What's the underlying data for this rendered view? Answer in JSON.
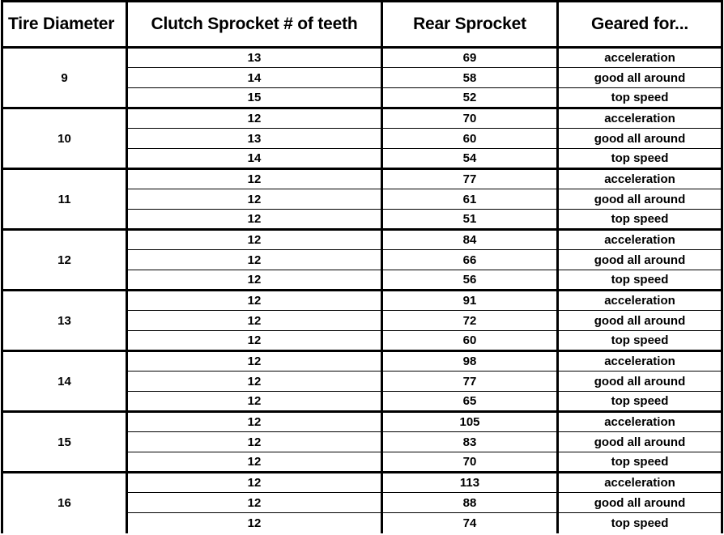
{
  "table": {
    "columns": [
      {
        "key": "tire",
        "label": "Tire Diameter"
      },
      {
        "key": "clutch",
        "label": "Clutch Sprocket # of teeth"
      },
      {
        "key": "rear",
        "label": "Rear Sprocket"
      },
      {
        "key": "geared",
        "label": "Geared for..."
      }
    ],
    "groups": [
      {
        "tire_diameter": "9",
        "rows": [
          {
            "clutch": "13",
            "rear": "69",
            "geared": "acceleration"
          },
          {
            "clutch": "14",
            "rear": "58",
            "geared": "good all around"
          },
          {
            "clutch": "15",
            "rear": "52",
            "geared": "top speed"
          }
        ]
      },
      {
        "tire_diameter": "10",
        "rows": [
          {
            "clutch": "12",
            "rear": "70",
            "geared": "acceleration"
          },
          {
            "clutch": "13",
            "rear": "60",
            "geared": "good all around"
          },
          {
            "clutch": "14",
            "rear": "54",
            "geared": "top speed"
          }
        ]
      },
      {
        "tire_diameter": "11",
        "rows": [
          {
            "clutch": "12",
            "rear": "77",
            "geared": "acceleration"
          },
          {
            "clutch": "12",
            "rear": "61",
            "geared": "good all around"
          },
          {
            "clutch": "12",
            "rear": "51",
            "geared": "top speed"
          }
        ]
      },
      {
        "tire_diameter": "12",
        "rows": [
          {
            "clutch": "12",
            "rear": "84",
            "geared": "acceleration"
          },
          {
            "clutch": "12",
            "rear": "66",
            "geared": "good all around"
          },
          {
            "clutch": "12",
            "rear": "56",
            "geared": "top speed"
          }
        ]
      },
      {
        "tire_diameter": "13",
        "rows": [
          {
            "clutch": "12",
            "rear": "91",
            "geared": "acceleration"
          },
          {
            "clutch": "12",
            "rear": "72",
            "geared": "good all around"
          },
          {
            "clutch": "12",
            "rear": "60",
            "geared": "top speed"
          }
        ]
      },
      {
        "tire_diameter": "14",
        "rows": [
          {
            "clutch": "12",
            "rear": "98",
            "geared": "acceleration"
          },
          {
            "clutch": "12",
            "rear": "77",
            "geared": "good all around"
          },
          {
            "clutch": "12",
            "rear": "65",
            "geared": "top speed"
          }
        ]
      },
      {
        "tire_diameter": "15",
        "rows": [
          {
            "clutch": "12",
            "rear": "105",
            "geared": "acceleration"
          },
          {
            "clutch": "12",
            "rear": "83",
            "geared": "good all around"
          },
          {
            "clutch": "12",
            "rear": "70",
            "geared": "top speed"
          }
        ]
      },
      {
        "tire_diameter": "16",
        "rows": [
          {
            "clutch": "12",
            "rear": "113",
            "geared": "acceleration"
          },
          {
            "clutch": "12",
            "rear": "88",
            "geared": "good all around"
          },
          {
            "clutch": "12",
            "rear": "74",
            "geared": "top speed"
          }
        ]
      }
    ]
  },
  "colors": {
    "text": "#000000",
    "background": "#ffffff",
    "border": "#000000"
  }
}
